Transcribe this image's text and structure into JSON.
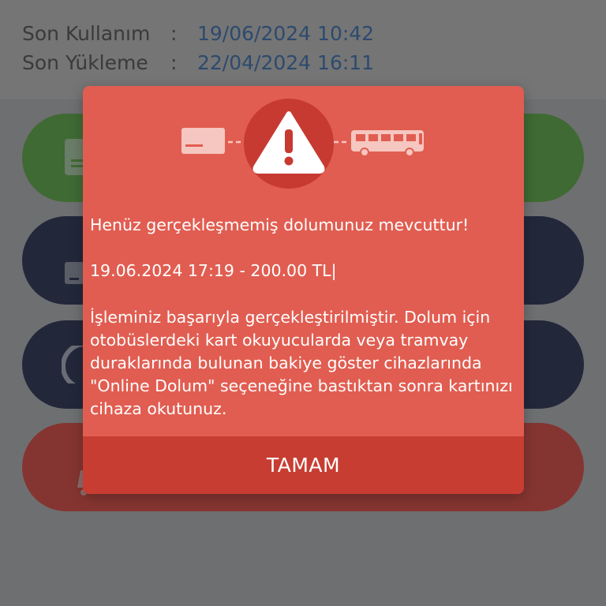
{
  "card_info": {
    "last_used_label": "Son Kullanım",
    "last_used_value": "19/06/2024 10:42",
    "last_load_label": "Son Yükleme",
    "last_load_value": "22/04/2024 16:11",
    "separator": ":"
  },
  "background_menu": [
    {
      "color": "#3f6a33",
      "icon": "card-icon"
    },
    {
      "color": "#22283a",
      "icon": "card-load-icon"
    },
    {
      "color": "#22283a",
      "icon": "history-icon"
    },
    {
      "color": "#853531",
      "icon": "report-icon"
    }
  ],
  "dialog": {
    "icons": [
      "card-icon",
      "warning-icon",
      "bus-icon"
    ],
    "heading": "Henüz gerçekleşmemiş dolumunuz mevcuttur!",
    "amount_line": "19.06.2024 17:19 - 200.00 TL|",
    "message": "İşleminiz başarıyla gerçekleştirilmiştir. Dolum için otobüslerdeki kart okuyucularda veya tramvay duraklarında bulunan bakiye göster cihazlarında \"Online Dolum\" seçeneğine bastıktan sonra kartınızı cihaza okutunuz.",
    "ok_label": "TAMAM"
  },
  "colors": {
    "dialog_bg": "#e15d51",
    "button_bg": "#c83d32",
    "warning_circle": "#c73a31",
    "overlay": "#6e6f71"
  }
}
